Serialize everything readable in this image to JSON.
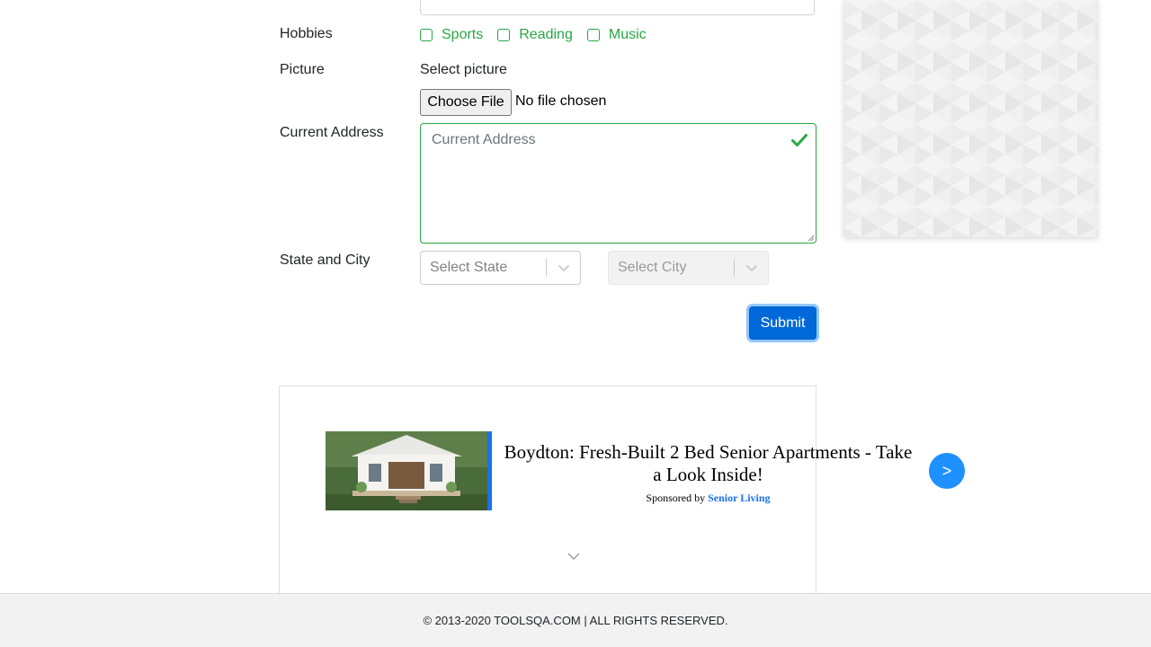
{
  "form": {
    "hobbies": {
      "label": "Hobbies",
      "options": [
        "Sports",
        "Reading",
        "Music"
      ]
    },
    "picture": {
      "label": "Picture",
      "select_label": "Select picture",
      "button_label": "Choose File",
      "status": "No file chosen"
    },
    "address": {
      "label": "Current Address",
      "placeholder": "Current Address"
    },
    "state_city": {
      "label": "State and City",
      "state_placeholder": "Select State",
      "city_placeholder": "Select City"
    },
    "submit_label": "Submit"
  },
  "ad": {
    "title": "Boydton: Fresh-Built 2 Bed Senior Apartments - Take a Look Inside!",
    "sponsored_prefix": "Sponsored by",
    "sponsor": "Senior Living",
    "next_label": ">"
  },
  "footer": {
    "text": "© 2013-2020 TOOLSQA.COM | ALL RIGHTS RESERVED."
  },
  "colors": {
    "valid_green": "#28a745",
    "submit_blue": "#0069d9",
    "ad_accent": "#1a73e8",
    "next_button": "#1e90ff"
  }
}
